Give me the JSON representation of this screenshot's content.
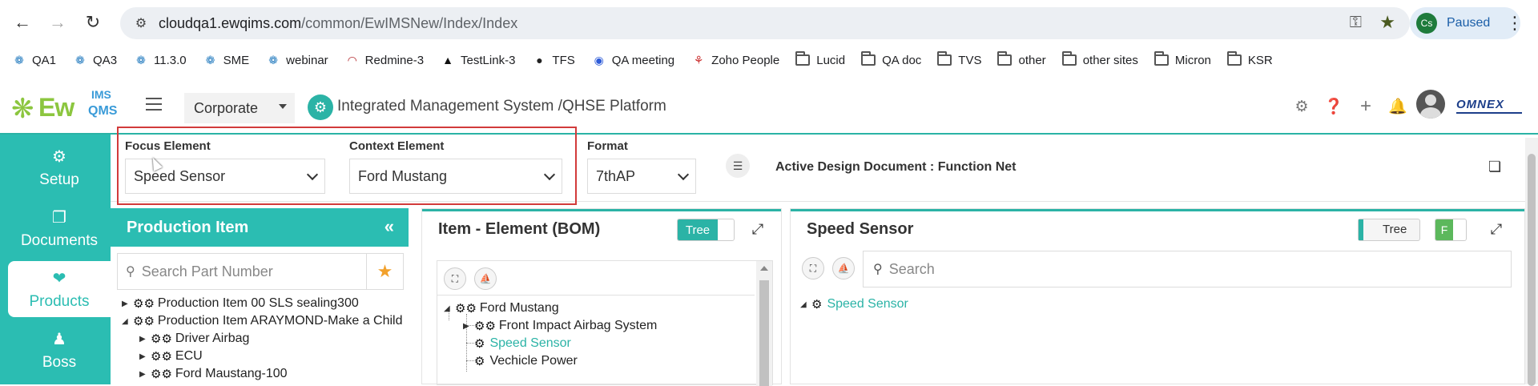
{
  "browser": {
    "url_host": "cloudqa1.ewqims.com",
    "url_path": "/common/EwIMSNew/Index/Index",
    "profile_initials": "Cs",
    "profile_status": "Paused",
    "bookmarks": [
      {
        "label": "QA1",
        "icon": "ewqims-logo-icon"
      },
      {
        "label": "QA3",
        "icon": "ewqims-logo-icon"
      },
      {
        "label": "11.3.0",
        "icon": "ewqims-logo-icon"
      },
      {
        "label": "SME",
        "icon": "ewqims-logo-icon"
      },
      {
        "label": "webinar",
        "icon": "ewqims-logo-icon"
      },
      {
        "label": "Redmine-3",
        "icon": "redmine-icon"
      },
      {
        "label": "TestLink-3",
        "icon": "testlink-icon"
      },
      {
        "label": "TFS",
        "icon": "globe-icon"
      },
      {
        "label": "QA meeting",
        "icon": "zoom-icon"
      },
      {
        "label": "Zoho People",
        "icon": "zoho-icon"
      },
      {
        "label": "Lucid",
        "icon": "folder-icon"
      },
      {
        "label": "QA doc",
        "icon": "folder-icon"
      },
      {
        "label": "TVS",
        "icon": "folder-icon"
      },
      {
        "label": "other",
        "icon": "folder-icon"
      },
      {
        "label": "other sites",
        "icon": "folder-icon"
      },
      {
        "label": "Micron",
        "icon": "folder-icon"
      },
      {
        "label": "KSR",
        "icon": "folder-icon"
      }
    ]
  },
  "header": {
    "logo_main": "Ew",
    "logo_ims": "IMS",
    "logo_qms": "QMS",
    "corporate_select": "Corporate",
    "title": "Integrated Management System /QHSE Platform",
    "vendor_logo": "OMNEX"
  },
  "sidebar": {
    "items": [
      {
        "label": "Setup",
        "icon": "gears-icon",
        "active": false
      },
      {
        "label": "Documents",
        "icon": "documents-icon",
        "active": false
      },
      {
        "label": "Products",
        "icon": "products-icon",
        "active": true
      },
      {
        "label": "Boss",
        "icon": "boss-icon",
        "active": false
      }
    ]
  },
  "filters": {
    "focus_label": "Focus Element",
    "focus_value": "Speed Sensor",
    "context_label": "Context Element",
    "context_value": "Ford Mustang",
    "format_label": "Format",
    "format_value": "7thAP",
    "active_doc": "Active Design Document : Function Net"
  },
  "production_panel": {
    "title": "Production Item",
    "search_placeholder": "Search Part Number",
    "tree": [
      {
        "label": "Production Item 00 SLS sealing300",
        "level": 0
      },
      {
        "label": "Production Item ARAYMOND-Make a Child",
        "level": 0
      },
      {
        "label": "Driver Airbag",
        "level": 1
      },
      {
        "label": "ECU",
        "level": 1
      },
      {
        "label": "Ford Maustang-100",
        "level": 1
      }
    ]
  },
  "bom_panel": {
    "title": "Item - Element (BOM)",
    "toggle_label": "Tree",
    "tree": [
      {
        "label": "Ford Mustang",
        "level": 0
      },
      {
        "label": "Front Impact Airbag System",
        "level": 1
      },
      {
        "label": "Speed Sensor",
        "level": 1,
        "selected": true
      },
      {
        "label": "Vechicle Power",
        "level": 1
      }
    ]
  },
  "sensor_panel": {
    "title": "Speed Sensor",
    "toggle_label": "Tree",
    "toggle_f": "F",
    "search_placeholder": "Search",
    "tree": [
      {
        "label": "Speed Sensor",
        "level": 0,
        "selected": true
      }
    ]
  }
}
